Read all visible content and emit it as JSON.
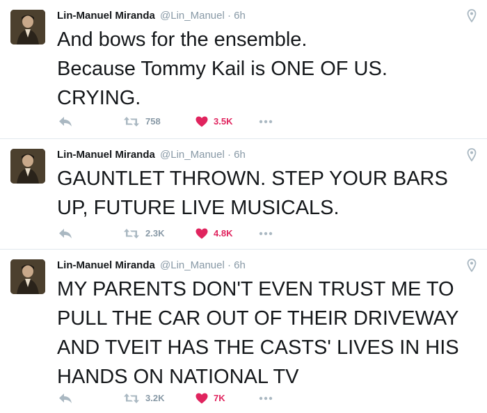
{
  "author": {
    "name": "Lin-Manuel Miranda",
    "handle": "@Lin_Manuel",
    "separator": "·",
    "time": "6h"
  },
  "icons": {
    "reply": "reply-arrow-icon",
    "retweet": "retweet-icon",
    "like": "heart-icon",
    "more": "more-dots-icon",
    "geo": "location-pin-icon"
  },
  "colors": {
    "name": "#14171a",
    "meta": "#8899a6",
    "like": "#e0245e",
    "divider": "#e1e8ed"
  },
  "tweets": [
    {
      "lines": [
        "And bows for the ensemble.",
        "Because Tommy Kail is ONE OF US.",
        "CRYING."
      ],
      "retweets": "758",
      "likes": "3.5K"
    },
    {
      "lines": [
        "GAUNTLET THROWN. STEP YOUR BARS",
        "UP, FUTURE LIVE MUSICALS."
      ],
      "retweets": "2.3K",
      "likes": "4.8K"
    },
    {
      "lines": [
        "MY PARENTS DON'T EVEN TRUST ME TO",
        "PULL THE CAR OUT OF THEIR DRIVEWAY",
        "AND TVEIT HAS THE CASTS' LIVES IN HIS",
        "HANDS ON NATIONAL TV"
      ],
      "retweets": "3.2K",
      "likes": "7K"
    }
  ]
}
